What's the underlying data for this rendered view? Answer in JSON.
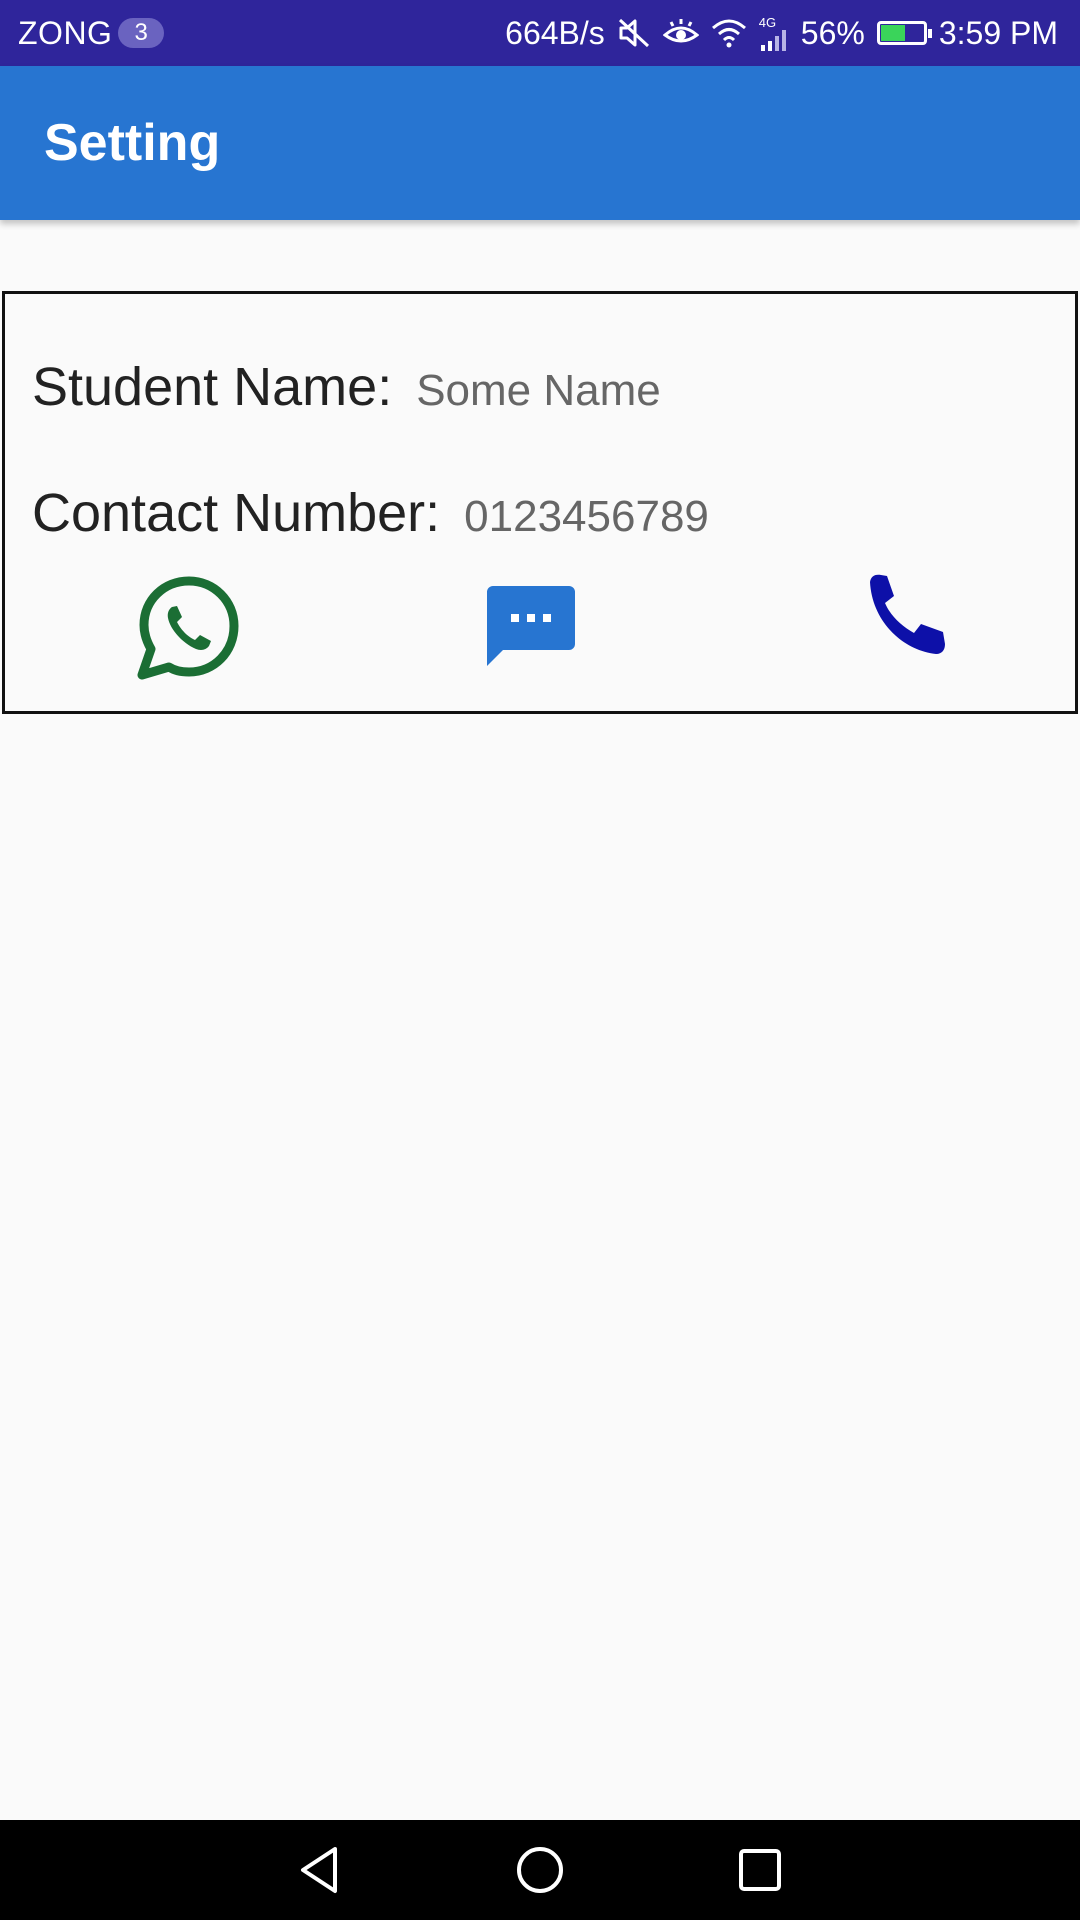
{
  "status_bar": {
    "carrier": "ZONG",
    "sim_badge": "3",
    "network_speed": "664B/s",
    "network_type": "4G",
    "battery_percent": "56%",
    "battery_level": 0.56,
    "time": "3:59 PM",
    "icons": [
      "mute-icon",
      "eye-comfort-icon",
      "wifi-icon",
      "signal-icon",
      "battery-icon"
    ]
  },
  "app_bar": {
    "title": "Setting",
    "color": "#2775d1"
  },
  "card": {
    "student_name_label": "Student Name:",
    "student_name_value": "Some Name",
    "contact_label": "Contact Number:",
    "contact_value": "0123456789",
    "actions": [
      {
        "icon": "whatsapp-icon",
        "color": "#1b6e34"
      },
      {
        "icon": "message-icon",
        "color": "#2775d1"
      },
      {
        "icon": "phone-icon",
        "color": "#0d10a8"
      }
    ]
  },
  "nav_bar": {
    "buttons": [
      "back-icon",
      "home-icon",
      "recents-icon"
    ]
  }
}
